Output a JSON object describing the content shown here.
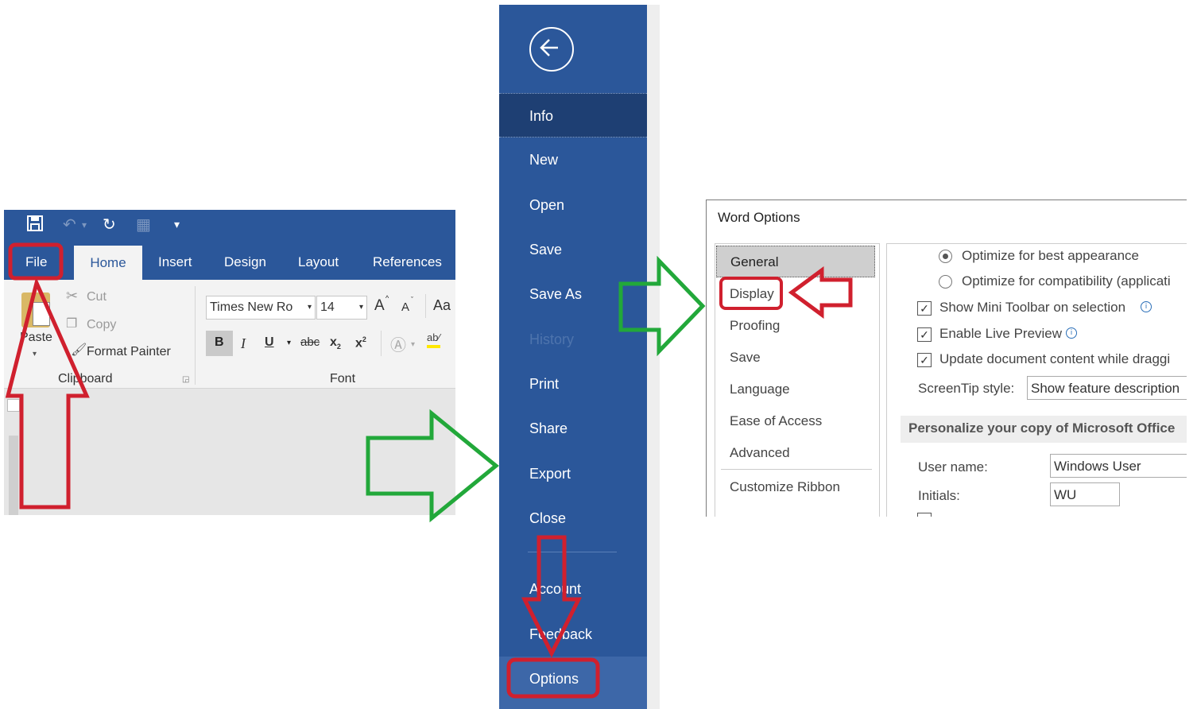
{
  "ribbon": {
    "tabs": [
      "File",
      "Home",
      "Insert",
      "Design",
      "Layout",
      "References"
    ],
    "clipboard": {
      "paste": "Paste",
      "cut": "Cut",
      "copy": "Copy",
      "format_painter": "Format Painter",
      "group": "Clipboard"
    },
    "font": {
      "font_name": "Times New Ro",
      "font_size": "14",
      "grow": "A",
      "shrink": "A",
      "case": "Aa",
      "bold": "B",
      "italic": "I",
      "underline": "U",
      "strikethrough": "abc",
      "subscript": "x",
      "superscript": "x",
      "group": "Font"
    }
  },
  "backstage": {
    "items": [
      "Info",
      "New",
      "Open",
      "Save",
      "Save As",
      "History",
      "Print",
      "Share",
      "Export",
      "Close",
      "Account",
      "Feedback",
      "Options"
    ],
    "selected": "Info"
  },
  "word_options": {
    "title": "Word Options",
    "nav": [
      "General",
      "Display",
      "Proofing",
      "Save",
      "Language",
      "Ease of Access",
      "Advanced",
      "Customize Ribbon"
    ],
    "selected_nav": "General",
    "radio_best": "Optimize for best appearance",
    "radio_compat": "Optimize for compatibility (applicati",
    "mini_toolbar": "Show Mini Toolbar on selection",
    "live_preview": "Enable Live Preview",
    "update_content": "Update document content while draggi",
    "screentip_label": "ScreenTip style:",
    "screentip_value": "Show feature description",
    "personalize_header": "Personalize your copy of Microsoft Office",
    "username_label": "User name:",
    "username_value": "Windows User",
    "initials_label": "Initials:",
    "initials_value": "WU"
  },
  "colors": {
    "word_blue": "#2b579a",
    "highlight_red": "#d0202e",
    "arrow_green": "#22a83a"
  }
}
